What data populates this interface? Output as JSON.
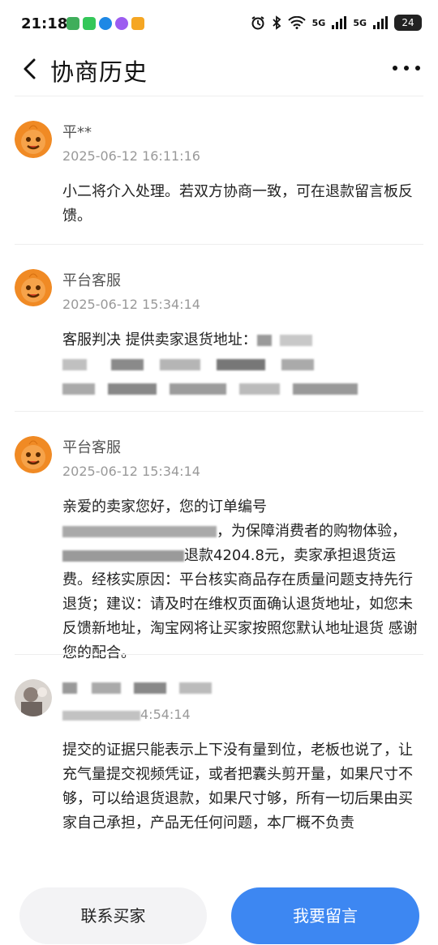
{
  "status_bar": {
    "time": "21:18",
    "battery": "24",
    "signal_1": "5G",
    "signal_2": "5G"
  },
  "header": {
    "title": "协商历史"
  },
  "entries": [
    {
      "name": "平**",
      "time": "2025-06-12 16:11:16",
      "content": "小二将介入处理。若双方协商一致，可在退款留言板反馈。"
    },
    {
      "name": "平台客服",
      "time": "2025-06-12 15:34:14",
      "content_prefix": "客服判决 提供卖家退货地址："
    },
    {
      "name": "平台客服",
      "time": "2025-06-12 15:34:14",
      "content_line1": "亲爱的卖家您好，您的订单编号",
      "content_mid": "，为保障消费者的购物体验，",
      "content_amount": "退款4204.8元，卖家承担退货运费。",
      "content_rest": "经核实原因：平台核实商品存在质量问题支持先行退货；建议：请及时在维权页面确认退货地址，如您未反馈新地址，淘宝网将让买家按照您默认地址退货 感谢您的配合。"
    },
    {
      "name_suffix": "",
      "time_suffix": "4:54:14",
      "content": "提交的证据只能表示上下没有量到位，老板也说了，让充气量提交视频凭证，或者把囊头剪开量，如果尺寸不够，可以给退货退款，如果尺寸够，所有一切后果由买家自己承担，产品无任何问题，本厂概不负责"
    }
  ],
  "actions": {
    "contact_buyer": "联系买家",
    "leave_message": "我要留言"
  },
  "colors": {
    "primary": "#3d87f2",
    "avatar_orange": "#f08a24",
    "divider": "#eeeeee"
  }
}
